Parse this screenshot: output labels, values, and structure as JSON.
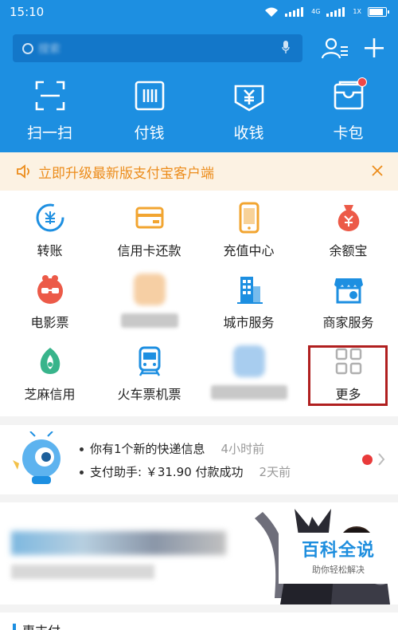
{
  "status_bar": {
    "time": "15:10",
    "network_label": "4G",
    "network_sub": "1X"
  },
  "search": {
    "placeholder": "搜索"
  },
  "quick_actions": [
    {
      "label": "扫一扫",
      "icon": "scan-icon"
    },
    {
      "label": "付钱",
      "icon": "pay-barcode-icon"
    },
    {
      "label": "收钱",
      "icon": "receive-money-icon"
    },
    {
      "label": "卡包",
      "icon": "card-wallet-icon",
      "badge": true
    }
  ],
  "banner": {
    "text": "立即升级最新版支付宝客户端"
  },
  "grid": [
    {
      "label": "转账",
      "icon": "transfer-icon"
    },
    {
      "label": "信用卡还款",
      "icon": "credit-card-icon"
    },
    {
      "label": "充值中心",
      "icon": "phone-recharge-icon"
    },
    {
      "label": "余额宝",
      "icon": "money-bag-icon"
    },
    {
      "label": "电影票",
      "icon": "movie-ticket-icon"
    },
    {
      "label": "",
      "icon": "blurred-icon"
    },
    {
      "label": "城市服务",
      "icon": "city-service-icon"
    },
    {
      "label": "商家服务",
      "icon": "merchant-service-icon"
    },
    {
      "label": "芝麻信用",
      "icon": "sesame-credit-icon"
    },
    {
      "label": "火车票机票",
      "icon": "train-ticket-icon"
    },
    {
      "label": "",
      "icon": "blurred-icon"
    },
    {
      "label": "更多",
      "icon": "more-grid-icon"
    }
  ],
  "messages": [
    {
      "text": "你有1个新的快递信息",
      "time": "4小时前"
    },
    {
      "text": "支付助手: ￥31.90 付款成功",
      "time": "2天前"
    }
  ],
  "watermark": {
    "title": "百科全说",
    "subtitle": "助你轻松解决"
  },
  "section": {
    "title": "惠支付"
  },
  "colors": {
    "brand_blue": "#1d8fe1",
    "banner_orange": "#ec8c1b",
    "highlight_red": "#b01f1f"
  }
}
